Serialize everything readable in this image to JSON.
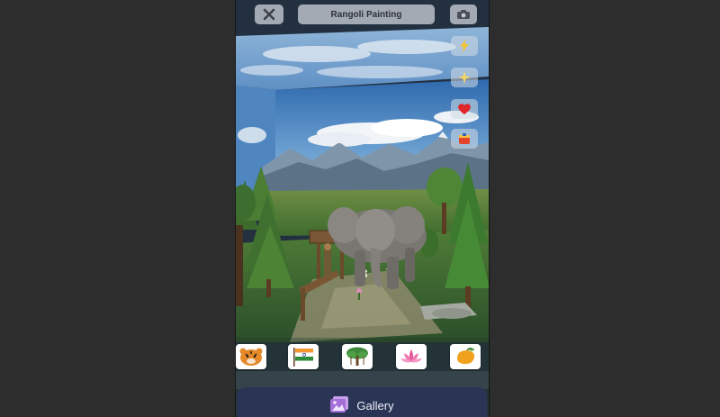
{
  "header": {
    "title": "Rangoli Painting",
    "close_icon": "close-icon",
    "camera_icon": "camera-icon"
  },
  "side_tools": [
    {
      "icon": "lightning-icon"
    },
    {
      "icon": "sparkle-icon"
    },
    {
      "icon": "heart-icon"
    },
    {
      "icon": "paint-bucket-icon"
    }
  ],
  "stickers": [
    {
      "name": "tiger",
      "icon": "tiger-icon"
    },
    {
      "name": "india-flag",
      "icon": "india-flag-icon"
    },
    {
      "name": "banyan-tree",
      "icon": "banyan-tree-icon"
    },
    {
      "name": "lotus",
      "icon": "lotus-icon"
    },
    {
      "name": "mango",
      "icon": "mango-icon"
    }
  ],
  "gallery": {
    "label": "Gallery",
    "icon": "gallery-icon"
  },
  "colors": {
    "background": "#2c2d2c",
    "sky": "#3e79bb",
    "grass": "#5f8a3c",
    "gallery_bar": "#2a3556",
    "pill": "#c8cdd4"
  }
}
